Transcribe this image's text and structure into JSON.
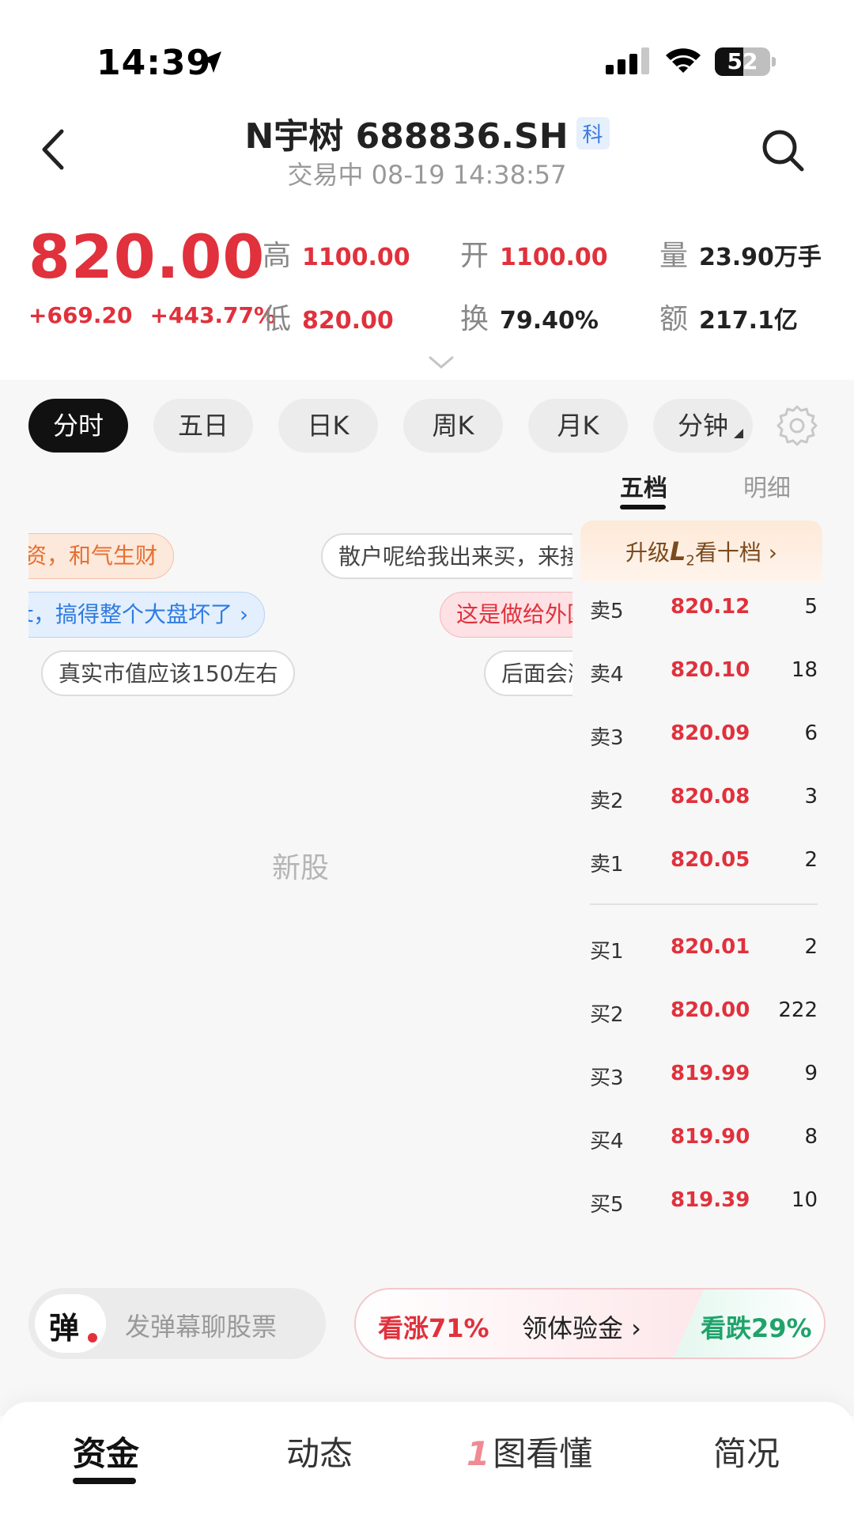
{
  "status_bar": {
    "time": "14:39",
    "battery": "52",
    "battery_level": 0.52
  },
  "header": {
    "title": "N宇树 688836.SH",
    "board_tag": "科",
    "subtitle": "交易中 08-19 14:38:57"
  },
  "quote": {
    "price": "820.00",
    "change": "+669.20",
    "change_pct": "+443.77%",
    "fields": [
      {
        "key": "高",
        "value": "1100.00",
        "tone": "red"
      },
      {
        "key": "开",
        "value": "1100.00",
        "tone": "red"
      },
      {
        "key": "量",
        "value": "23.90万手",
        "tone": "dark"
      },
      {
        "key": "低",
        "value": "820.00",
        "tone": "red"
      },
      {
        "key": "换",
        "value": "79.40%",
        "tone": "dark"
      },
      {
        "key": "额",
        "value": "217.1亿",
        "tone": "dark"
      }
    ]
  },
  "chart_tabs": {
    "active": 0,
    "items": [
      "分时",
      "五日",
      "日K",
      "周K",
      "月K",
      "分钟"
    ]
  },
  "orderbook": {
    "tabs": [
      "五档",
      "明细"
    ],
    "active_tab": 0,
    "upgrade_prefix": "升级",
    "upgrade_l": "L",
    "upgrade_2": "2",
    "upgrade_suffix": "看十档 ›",
    "asks": [
      {
        "label": "卖5",
        "price": "820.12",
        "qty": "5"
      },
      {
        "label": "卖4",
        "price": "820.10",
        "qty": "18"
      },
      {
        "label": "卖3",
        "price": "820.09",
        "qty": "6"
      },
      {
        "label": "卖2",
        "price": "820.08",
        "qty": "3"
      },
      {
        "label": "卖1",
        "price": "820.05",
        "qty": "2"
      }
    ],
    "bids": [
      {
        "label": "买1",
        "price": "820.01",
        "qty": "2"
      },
      {
        "label": "买2",
        "price": "820.00",
        "qty": "222"
      },
      {
        "label": "买3",
        "price": "819.99",
        "qty": "9"
      },
      {
        "label": "买4",
        "price": "819.90",
        "qty": "8"
      },
      {
        "label": "买5",
        "price": "819.39",
        "qty": "10"
      }
    ]
  },
  "danmaku": [
    {
      "text": "资，和气生财",
      "style": "orange"
    },
    {
      "text": "散户呢给我出来买，来接",
      "style": "white"
    },
    {
      "text": "t，搞得整个大盘坏了 ›",
      "style": "blue"
    },
    {
      "text": "这是做给外国",
      "style": "pink"
    },
    {
      "text": "真实市值应该150左右",
      "style": "white"
    },
    {
      "text": "后面会涨",
      "style": "white"
    }
  ],
  "chart_placeholder": "新股",
  "bottom_bar": {
    "danmu_char": "弹",
    "danmu_placeholder": "发弹幕聊股票",
    "vote_up": "看涨71%",
    "vote_claim": "领体验金 ›",
    "vote_down": "看跌29%"
  },
  "bottom_nav": {
    "active": 0,
    "items": [
      "资金",
      "动态",
      "图看懂",
      "简况"
    ],
    "prefix_one": "1"
  },
  "colors": {
    "up_red": "#e0313c",
    "down_green": "#1fa36b",
    "tag_blue": "#3a7be0"
  }
}
